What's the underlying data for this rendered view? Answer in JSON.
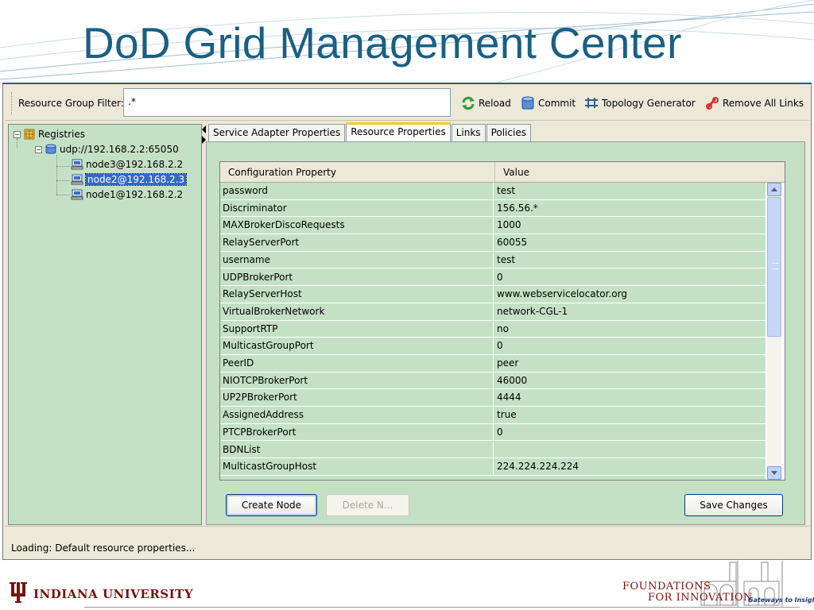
{
  "slide": {
    "title": "DoD Grid Management Center",
    "footer": {
      "university": "INDIANA UNIVERSITY",
      "logo_line1": "FOUNDATIONS",
      "logo_line2": "FOR INNOVATION",
      "logo_tagline": "Gateways to Insight"
    }
  },
  "toolbar": {
    "filter_label": "Resource Group Filter:",
    "filter_value": ".*",
    "buttons": [
      {
        "label": "Reload",
        "icon": "reload-icon"
      },
      {
        "label": "Commit",
        "icon": "database-icon"
      },
      {
        "label": "Topology Generator",
        "icon": "topology-icon"
      },
      {
        "label": "Remove All Links",
        "icon": "remove-links-icon"
      }
    ]
  },
  "tree": {
    "root": "Registries",
    "registry": "udp://192.168.2.2:65050",
    "nodes": [
      "node3@192.168.2.2",
      "node2@192.168.2.3",
      "node1@192.168.2.2"
    ],
    "selected": "node2@192.168.2.3"
  },
  "tabs": [
    "Service Adapter Properties",
    "Resource Properties",
    "Links",
    "Policies"
  ],
  "active_tab": "Resource Properties",
  "table": {
    "headers": [
      "Configuration Property",
      "Value"
    ],
    "rows": [
      [
        "password",
        "test"
      ],
      [
        "Discriminator",
        "156.56.*"
      ],
      [
        "MAXBrokerDiscoRequests",
        "1000"
      ],
      [
        "RelayServerPort",
        "60055"
      ],
      [
        "username",
        "test"
      ],
      [
        "UDPBrokerPort",
        "0"
      ],
      [
        "RelayServerHost",
        "www.webservicelocator.org"
      ],
      [
        "VirtualBrokerNetwork",
        "network-CGL-1"
      ],
      [
        "SupportRTP",
        "no"
      ],
      [
        "MulticastGroupPort",
        "0"
      ],
      [
        "PeerID",
        "peer"
      ],
      [
        "NIOTCPBrokerPort",
        "46000"
      ],
      [
        "UP2PBrokerPort",
        "4444"
      ],
      [
        "AssignedAddress",
        "true"
      ],
      [
        "PTCPBrokerPort",
        "0"
      ],
      [
        "BDNList",
        ""
      ],
      [
        "MulticastGroupHost",
        "224.224.224.224"
      ]
    ]
  },
  "buttons": {
    "create_node": "Create Node",
    "delete_node": "Delete N...",
    "save_changes": "Save Changes"
  },
  "status": "Loading: Default resource properties...",
  "colors": {
    "title": "#1a5f84",
    "panel_green": "#c5e1c5",
    "selection": "#316ac5",
    "iu_crimson": "#7d110c"
  }
}
